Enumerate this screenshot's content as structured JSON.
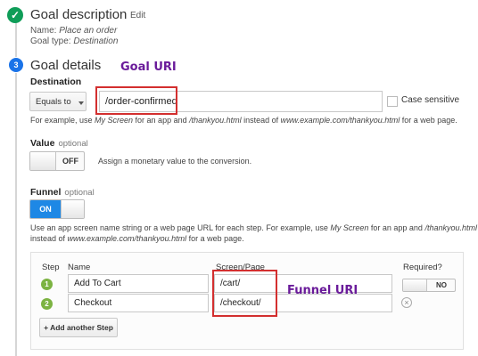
{
  "goal_description": {
    "title": "Goal description",
    "edit_label": "Edit",
    "name_label": "Name:",
    "name_value": "Place an order",
    "type_label": "Goal type:",
    "type_value": "Destination"
  },
  "goal_details": {
    "step_number": "3",
    "title": "Goal details",
    "annotation": "Goal URI",
    "destination_label": "Destination",
    "match_select": "Equals to",
    "destination_value": "/order-confirmed",
    "case_sensitive_label": "Case sensitive",
    "hint_parts": [
      "For example, use ",
      "My Screen",
      " for an app and ",
      "/thankyou.html",
      " instead of ",
      "www.example.com/thankyou.html",
      " for a web page."
    ]
  },
  "value": {
    "label": "Value",
    "optional": "optional",
    "toggle_state": "OFF",
    "description": "Assign a monetary value to the conversion."
  },
  "funnel": {
    "label": "Funnel",
    "optional": "optional",
    "toggle_state": "ON",
    "hint_line1_parts": [
      "Use an app screen name string or a web page URL for each step. For example, use ",
      "My Screen",
      " for an app and ",
      "/thankyou.html"
    ],
    "hint_line2_parts": [
      "instead of ",
      "www.example.com/thankyou.html",
      " for a web page."
    ],
    "table": {
      "headers": {
        "step": "Step",
        "name": "Name",
        "screen": "Screen/Page",
        "required": "Required?"
      },
      "rows": [
        {
          "step": "1",
          "name": "Add To Cart",
          "screen": "/cart/"
        },
        {
          "step": "2",
          "name": "Checkout",
          "screen": "/checkout/"
        }
      ],
      "required_toggle": "NO",
      "remove_icon": "×",
      "add_step_label": "+ Add another Step"
    },
    "annotation": "Funnel URI"
  },
  "colors": {
    "check_green": "#0f9d58",
    "step_blue": "#1a73e8",
    "toggle_on_blue": "#1e88e5",
    "annotation_red": "#d32f2f",
    "annotation_purple": "#6a1b9a"
  },
  "icons": {
    "check": "check-icon",
    "dropdown": "caret-down-icon",
    "remove": "remove-step-icon"
  }
}
